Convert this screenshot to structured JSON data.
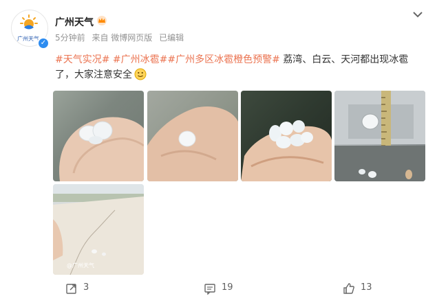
{
  "post": {
    "author_name": "广州天气",
    "avatar_logo_text": "广州天气",
    "meta": {
      "time": "5分钟前",
      "source": "来自 微博网页版",
      "edited": "已编辑"
    },
    "content": {
      "tag1": "#天气实况#",
      "tag2": "#广州冰雹#",
      "tag3": "#广州多区冰雹橙色预警#",
      "text": "荔湾、白云、天河都出现冰雹了，大家注意安全"
    },
    "image_watermark": "@广州天气",
    "actions": {
      "repost_count": "3",
      "comment_count": "19",
      "like_count": "13"
    }
  },
  "colors": {
    "tag": "#eb7350",
    "verified": "#2d8cf0",
    "meta": "#939393"
  },
  "icons": [
    "sun-logo-icon",
    "verified-icon",
    "crown-badge-icon",
    "chevron-down-icon",
    "smile-emoji-icon",
    "repost-icon",
    "comment-icon",
    "like-icon"
  ]
}
